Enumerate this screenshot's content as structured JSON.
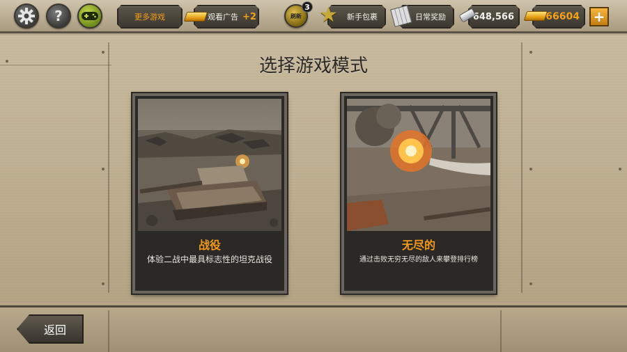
{
  "topbar": {
    "settings_icon": "gear-icon",
    "help_label": "?",
    "gamepad_icon": "gamepad-icon",
    "more_games_label": "更多游戏",
    "watch_ad_label": "观看广告",
    "watch_ad_bonus": "+2",
    "refresh_badge_count": "3",
    "refresh_icon_text": "刷新",
    "newbie_pack_label": "新手包裹",
    "daily_reward_label": "日常奖励",
    "silver_amount": "648,566",
    "gold_amount": "66604",
    "add_label": "+"
  },
  "main": {
    "title": "选择游戏模式",
    "modes": [
      {
        "name": "战役",
        "description": "体验二战中最具标志性的坦克战役",
        "image_icon": "tank-battlefield-image"
      },
      {
        "name": "无尽的",
        "description": "通过击败无穷无尽的敌人来攀登排行榜",
        "image_icon": "explosion-battlefield-image"
      }
    ]
  },
  "footer": {
    "back_label": "返回"
  },
  "colors": {
    "accent_orange": "#f39a1c",
    "gold_text": "#f3a01a"
  }
}
